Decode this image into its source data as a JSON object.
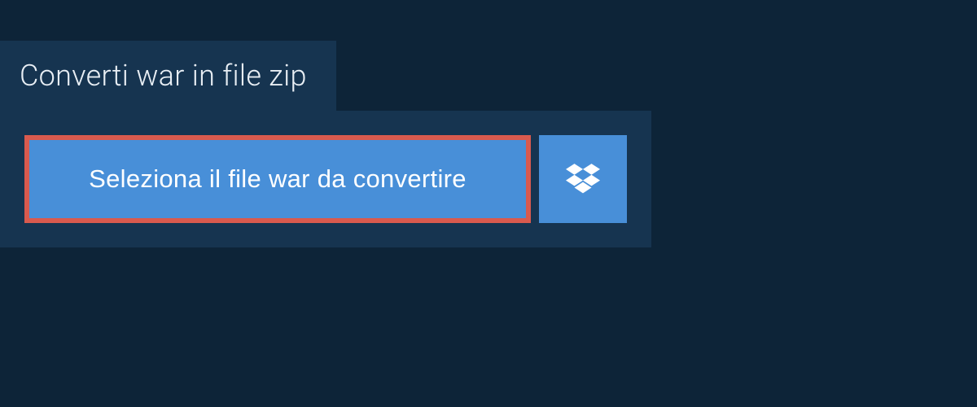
{
  "header": {
    "title": "Converti war in file zip"
  },
  "actions": {
    "select_file_label": "Seleziona il file war da convertire"
  },
  "colors": {
    "background_dark": "#0d2438",
    "panel": "#163450",
    "button_primary": "#488fd8",
    "highlight_border": "#d95a4e",
    "text_light": "#e8eef4"
  }
}
